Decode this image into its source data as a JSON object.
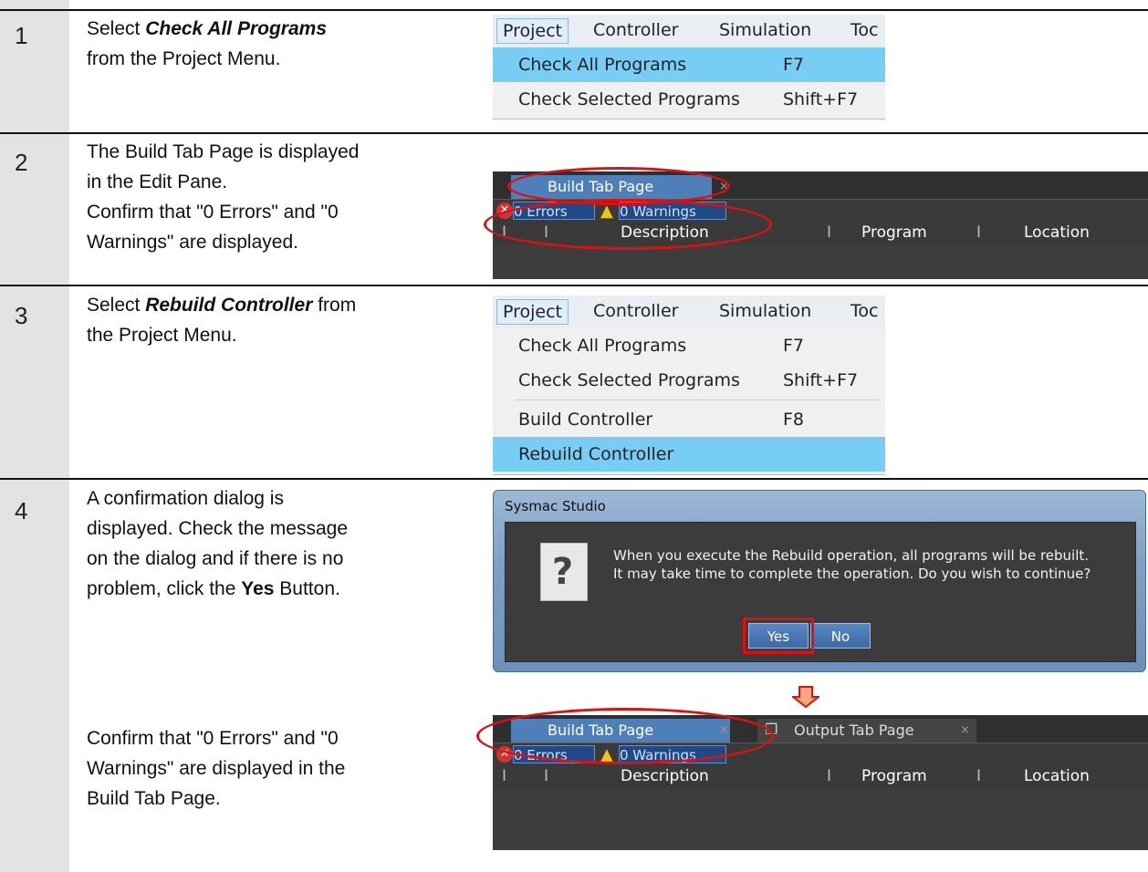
{
  "steps": [
    {
      "num": "1"
    },
    {
      "num": "2"
    },
    {
      "num": "3"
    },
    {
      "num": "4"
    }
  ],
  "step1": {
    "pre": "Select ",
    "item": "Check All Programs",
    "post": "from the Project Menu."
  },
  "step2": {
    "l1": "The Build Tab Page is displayed",
    "l2": "in the Edit Pane.",
    "l3": "Confirm that \"0 Errors\" and \"0",
    "l4": "Warnings\" are displayed."
  },
  "step3": {
    "pre": "Select ",
    "item": "Rebuild Controller",
    "post1": " from",
    "post2": "the Project Menu."
  },
  "step4": {
    "l1": "A confirmation dialog is",
    "l2": "displayed. Check the message",
    "l3": "on the dialog and if there is no",
    "l4pre": "problem, click the ",
    "l4b": "Yes",
    "l4post": " Button.",
    "c1": "Confirm that \"0 Errors\" and \"0",
    "c2": "Warnings\" are displayed in the",
    "c3": "Build Tab Page."
  },
  "menu": {
    "bar": [
      "Project",
      "Controller",
      "Simulation",
      "Toc"
    ],
    "check_all": "Check All Programs",
    "check_all_key": "F7",
    "check_sel": "Check Selected Programs",
    "check_sel_key": "Shift+F7",
    "build": "Build Controller",
    "build_key": "F8",
    "rebuild": "Rebuild Controller"
  },
  "pane": {
    "build_tab": "Build Tab Page",
    "output_tab": "Output Tab Page",
    "close": "×",
    "errors": "0  Errors",
    "warnings": "0  Warnings",
    "col_description": "Description",
    "col_program": "Program",
    "col_location": "Location",
    "divider": "I"
  },
  "dialog": {
    "title": "Sysmac Studio",
    "line1": "When you execute the Rebuild operation, all programs will be rebuilt.",
    "line2": "It may take time to complete the operation. Do you wish to continue?",
    "yes": "Yes",
    "no": "No",
    "icon": "question-icon"
  },
  "colors": {
    "highlight": "#78cdf5",
    "annotation": "#e01010",
    "arrow": "#f7a779",
    "tab": "#4f7fb8"
  }
}
